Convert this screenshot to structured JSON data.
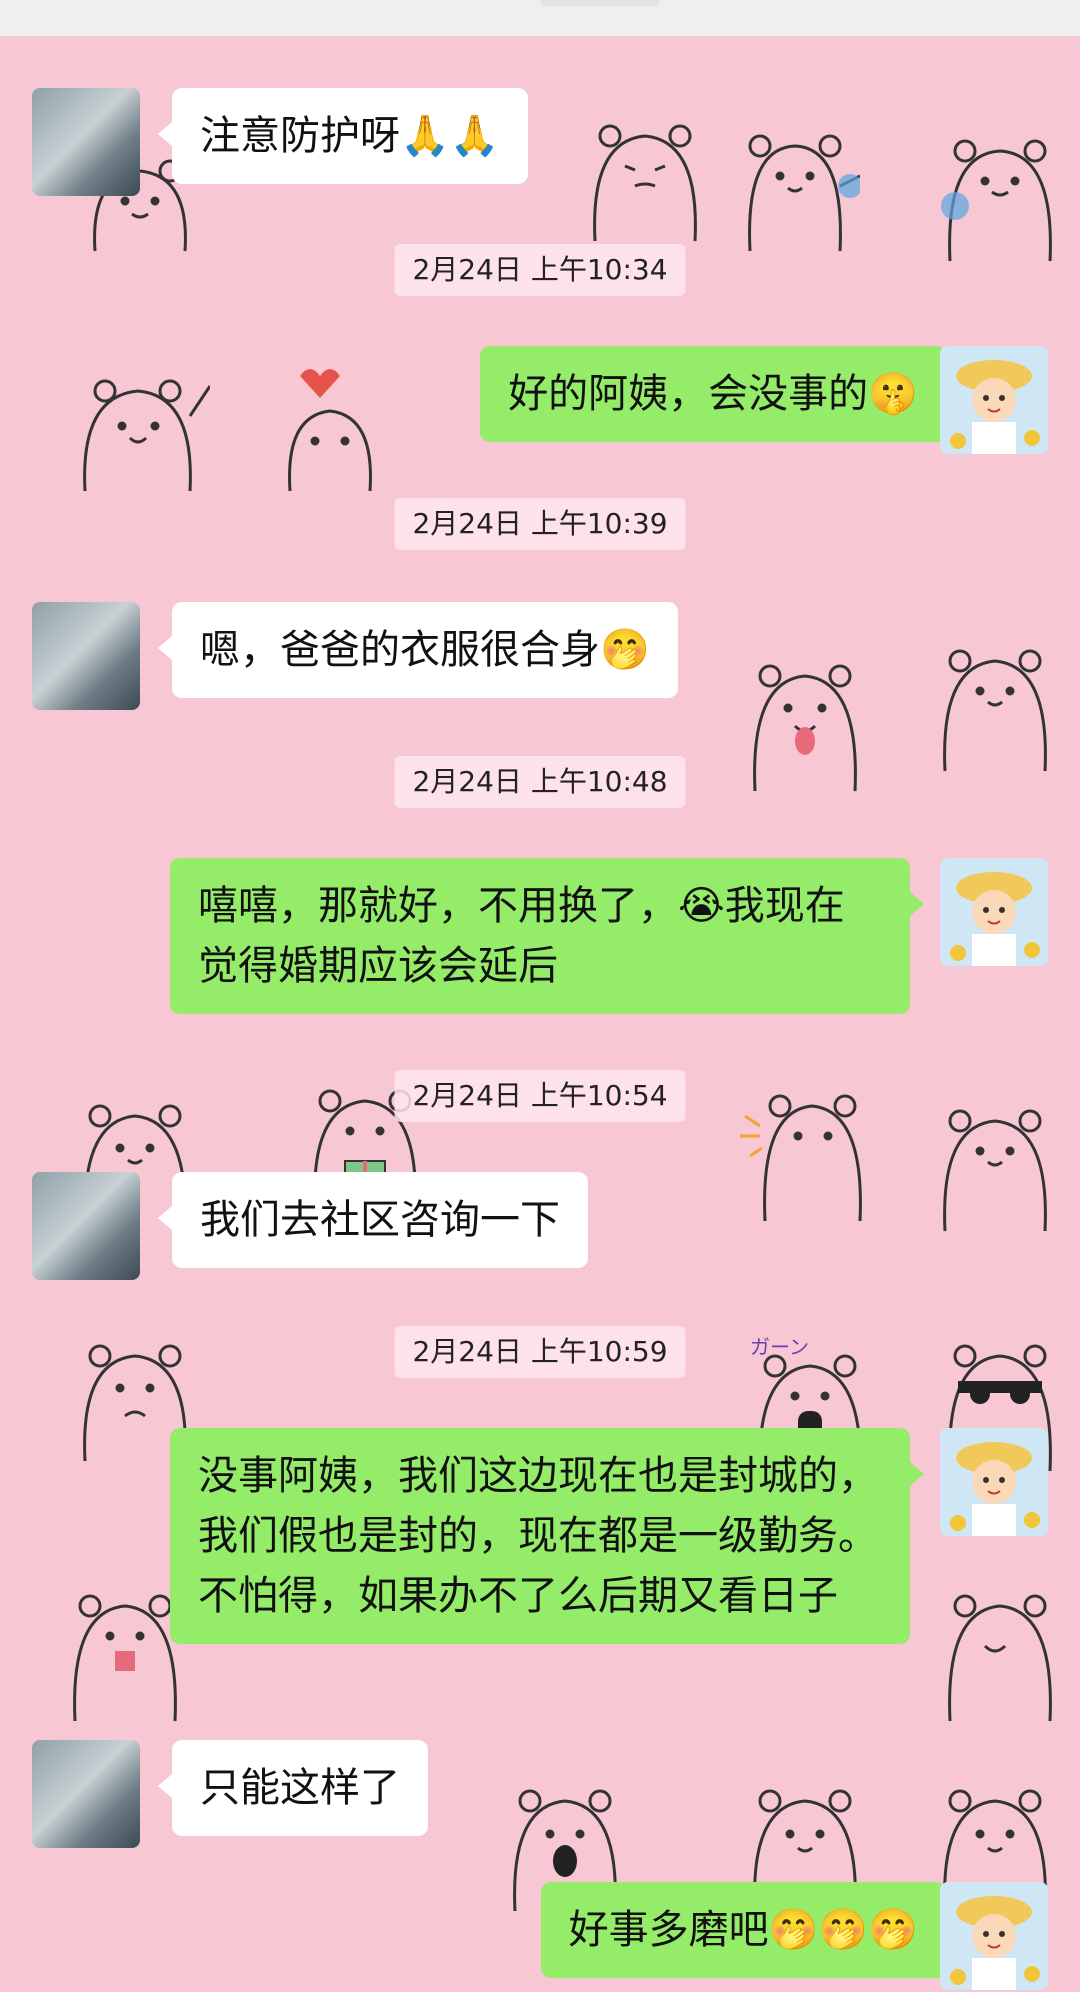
{
  "messages": [
    {
      "side": "in",
      "text": "注意防护呀🙏🙏"
    },
    {
      "timestamp": "2月24日 上午10:34"
    },
    {
      "side": "out",
      "text": "好的阿姨，会没事的🤫"
    },
    {
      "timestamp": "2月24日 上午10:39"
    },
    {
      "side": "in",
      "text": "嗯，爸爸的衣服很合身🤭"
    },
    {
      "timestamp": "2月24日 上午10:48"
    },
    {
      "side": "out",
      "text": "嘻嘻，那就好，不用换了，😭我现在觉得婚期应该会延后"
    },
    {
      "timestamp": "2月24日 上午10:54"
    },
    {
      "side": "in",
      "text": "我们去社区咨询一下"
    },
    {
      "timestamp": "2月24日 上午10:59"
    },
    {
      "side": "out",
      "text": "没事阿姨，我们这边现在也是封城的，我们假也是封的，现在都是一级勤务。不怕得，如果办不了么后期又看日子"
    },
    {
      "side": "in",
      "text": "只能这样了"
    },
    {
      "side": "out",
      "text": "好事多磨吧🤭🤭🤭"
    }
  ],
  "wallpaper": {
    "color": "#f7c7d4",
    "pattern": "white bear doodles"
  },
  "colors": {
    "incoming_bubble": "#ffffff",
    "outgoing_bubble": "#95ec69",
    "background": "#f7c7d4"
  }
}
